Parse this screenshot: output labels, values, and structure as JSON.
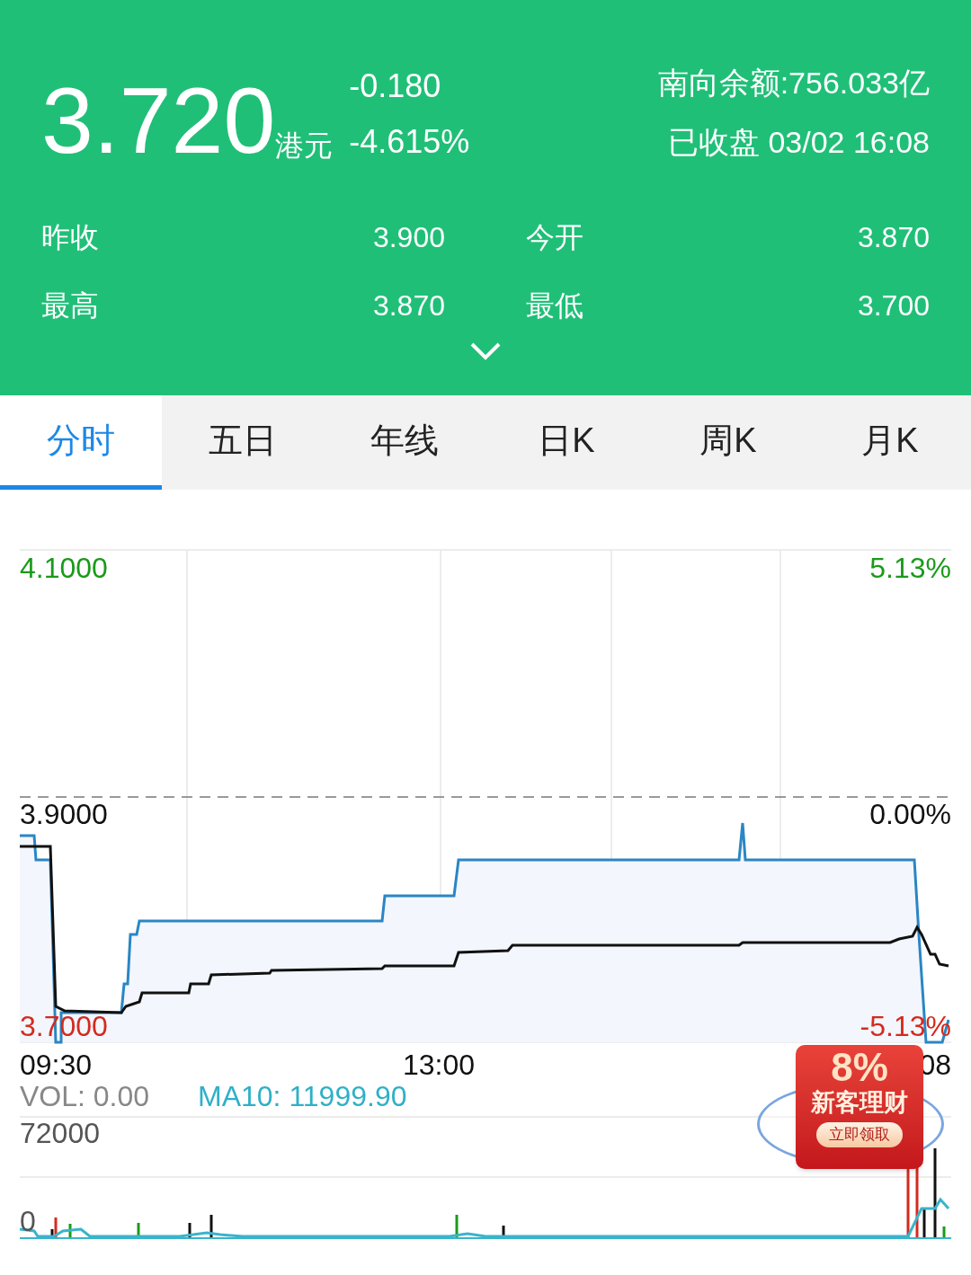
{
  "quote": {
    "price": "3.720",
    "currency": "港元",
    "change": "-0.180",
    "change_pct": "-4.615%",
    "southbound": "南向余额:756.033亿",
    "status": "已收盘 03/02 16:08"
  },
  "stats": [
    {
      "label": "昨收",
      "value": "3.900"
    },
    {
      "label": "今开",
      "value": "3.870"
    },
    {
      "label": "最高",
      "value": "3.870"
    },
    {
      "label": "最低",
      "value": "3.700"
    }
  ],
  "tabs": [
    {
      "label": "分时",
      "selected": true
    },
    {
      "label": "五日",
      "selected": false
    },
    {
      "label": "年线",
      "selected": false
    },
    {
      "label": "日K",
      "selected": false
    },
    {
      "label": "周K",
      "selected": false
    },
    {
      "label": "月K",
      "selected": false
    }
  ],
  "chart": {
    "left_labels": [
      {
        "text": "4.1000",
        "color": "#1a9a1a"
      },
      {
        "text": "3.9000",
        "color": "#111111"
      },
      {
        "text": "3.7000",
        "color": "#d42a1e"
      }
    ],
    "right_labels": [
      {
        "text": "5.13%",
        "color": "#1a9a1a"
      },
      {
        "text": "0.00%",
        "color": "#111111"
      },
      {
        "text": "-5.13%",
        "color": "#d42a1e"
      }
    ],
    "times": [
      "09:30",
      "13:00",
      "08"
    ]
  },
  "volume": {
    "vol": "VOL: 0.00",
    "ma10": "MA10: 11999.90",
    "ticks": [
      "72000",
      "0"
    ]
  },
  "promo": {
    "rate": "8%",
    "title": "新客理财",
    "button": "立即领取"
  }
}
